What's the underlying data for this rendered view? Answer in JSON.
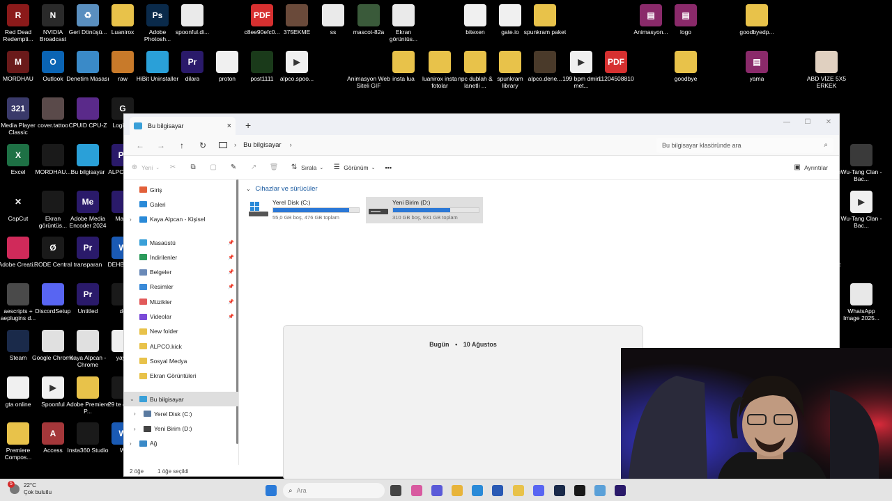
{
  "desktop": {
    "icons": [
      {
        "label": "Red Dead Redempti...",
        "color": "#8b1a1a",
        "glyph": "R"
      },
      {
        "label": "NVIDIA Broadcast",
        "color": "#2a2a2a",
        "glyph": "N"
      },
      {
        "label": "Geri Dönüşü...",
        "color": "#5a8fbf",
        "glyph": "♻"
      },
      {
        "label": "Luanirox",
        "color": "#e8c24a",
        "glyph": ""
      },
      {
        "label": "Adobe Photosh...",
        "color": "#0a2a4a",
        "glyph": "Ps"
      },
      {
        "label": "spoonful.di...",
        "color": "#eaeaea",
        "glyph": ""
      },
      {
        "label": "c8ee90efc0...",
        "color": "#d63030",
        "glyph": "PDF"
      },
      {
        "label": "375EKME",
        "color": "#6a4a3a",
        "glyph": ""
      },
      {
        "label": "ss",
        "color": "#eaeaea",
        "glyph": ""
      },
      {
        "label": "mascot-82a",
        "color": "#3a5a3a",
        "glyph": ""
      },
      {
        "label": "Ekran görüntüs...",
        "color": "#eaeaea",
        "glyph": ""
      },
      {
        "label": "bitexen",
        "color": "#f0f0f0",
        "glyph": ""
      },
      {
        "label": "gate.io",
        "color": "#f0f0f0",
        "glyph": ""
      },
      {
        "label": "spunkram paket",
        "color": "#e8c24a",
        "glyph": ""
      },
      {
        "label": "Animasyon...",
        "color": "#8a2a6a",
        "glyph": "▤"
      },
      {
        "label": "logo",
        "color": "#8a2a6a",
        "glyph": "▤"
      },
      {
        "label": "goodbyedp...",
        "color": "#e8c24a",
        "glyph": ""
      },
      {
        "label": "MORDHAU",
        "color": "#6a1a1a",
        "glyph": "M"
      },
      {
        "label": "Outlook",
        "color": "#0a64b4",
        "glyph": "O"
      },
      {
        "label": "Denetim Masası",
        "color": "#3a8ac8",
        "glyph": ""
      },
      {
        "label": "raw",
        "color": "#c87a2a",
        "glyph": ""
      },
      {
        "label": "HiBit Uninstaller",
        "color": "#2aa0d8",
        "glyph": ""
      },
      {
        "label": "dilara",
        "color": "#2a1a6a",
        "glyph": "Pr"
      },
      {
        "label": "proton",
        "color": "#f0f0f0",
        "glyph": ""
      },
      {
        "label": "post1111",
        "color": "#1a3a1a",
        "glyph": ""
      },
      {
        "label": "alpco.spoo...",
        "color": "#f0f0f0",
        "glyph": "▶"
      },
      {
        "label": "Animasyon Web Siteli GIF",
        "color": "#000000",
        "glyph": ""
      },
      {
        "label": "insta lua",
        "color": "#e8c24a",
        "glyph": ""
      },
      {
        "label": "luanirox insta fotolar",
        "color": "#e8c24a",
        "glyph": ""
      },
      {
        "label": "npc dublah & lanetli ...",
        "color": "#e8c24a",
        "glyph": ""
      },
      {
        "label": "spunkram library",
        "color": "#e8c24a",
        "glyph": ""
      },
      {
        "label": "alpco.dene...",
        "color": "#4a3a2a",
        "glyph": ""
      },
      {
        "label": "199 bpm dmin met...",
        "color": "#f0f0f0",
        "glyph": "▶"
      },
      {
        "label": "11204508810",
        "color": "#d63030",
        "glyph": "PDF"
      },
      {
        "label": "goodbye",
        "color": "#e8c24a",
        "glyph": ""
      },
      {
        "label": "yama",
        "color": "#8a2a6a",
        "glyph": "▤"
      },
      {
        "label": "ABD VİZE 5X5 ERKEK",
        "color": "#e0d0c0",
        "glyph": ""
      },
      {
        "label": "Media Player Classic",
        "color": "#3a3a6a",
        "glyph": "321"
      },
      {
        "label": "cover.tattoo",
        "color": "#5a4a4a",
        "glyph": ""
      },
      {
        "label": "CPUID CPU-Z",
        "color": "#5a2a8a",
        "glyph": ""
      },
      {
        "label": "Logit HI",
        "color": "#1a1a1a",
        "glyph": "G"
      },
      {
        "label": "Excel",
        "color": "#1e7145",
        "glyph": "X"
      },
      {
        "label": "MORDHAU...",
        "color": "#1a1a1a",
        "glyph": ""
      },
      {
        "label": "Bu bilgisayar",
        "color": "#2aa0d8",
        "glyph": ""
      },
      {
        "label": "ALPC SEK",
        "color": "#2a1a6a",
        "glyph": "Pr"
      },
      {
        "label": "CapCut",
        "color": "#000000",
        "glyph": "✕"
      },
      {
        "label": "Ekran görüntüs...",
        "color": "#1a1a1a",
        "glyph": ""
      },
      {
        "label": "Adobe Media Encoder 2024",
        "color": "#2a1a6a",
        "glyph": "Me"
      },
      {
        "label": "Mage",
        "color": "#2a1a6a",
        "glyph": ""
      },
      {
        "label": "Adobe Creati...",
        "color": "#d02a5a",
        "glyph": ""
      },
      {
        "label": "RODE Central",
        "color": "#1a1a1a",
        "glyph": "Ø"
      },
      {
        "label": "transparan",
        "color": "#2a1a6a",
        "glyph": "Pr"
      },
      {
        "label": "DEHB- pod",
        "color": "#1a5ab4",
        "glyph": "W"
      },
      {
        "label": "aescripts + aeplugins d...",
        "color": "#4a4a4a",
        "glyph": ""
      },
      {
        "label": "DiscordSetup",
        "color": "#5865f2",
        "glyph": ""
      },
      {
        "label": "Untitled",
        "color": "#2a1a6a",
        "glyph": "Pr"
      },
      {
        "label": "dc",
        "color": "#1a1a1a",
        "glyph": ""
      },
      {
        "label": "Steam",
        "color": "#1a2a4a",
        "glyph": ""
      },
      {
        "label": "Google Chrome",
        "color": "#e0e0e0",
        "glyph": ""
      },
      {
        "label": "Kaya Alpcan - Chrome",
        "color": "#e0e0e0",
        "glyph": ""
      },
      {
        "label": "yayır",
        "color": "#f0f0f0",
        "glyph": ""
      },
      {
        "label": "gta online",
        "color": "#f0f0f0",
        "glyph": ""
      },
      {
        "label": "Spoonful",
        "color": "#f0f0f0",
        "glyph": "▶"
      },
      {
        "label": "Adobe Premiere P...",
        "color": "#e8c24a",
        "glyph": ""
      },
      {
        "label": "29 te 4 ağu",
        "color": "#1a1a1a",
        "glyph": ""
      },
      {
        "label": "Premiere Compos...",
        "color": "#e8c24a",
        "glyph": ""
      },
      {
        "label": "Access",
        "color": "#a4373a",
        "glyph": "A"
      },
      {
        "label": "Insta360 Studio",
        "color": "#1a1a1a",
        "glyph": ""
      },
      {
        "label": "W",
        "color": "#1a5ab4",
        "glyph": "W"
      },
      {
        "label": "ne",
        "color": "#000000",
        "glyph": ""
      },
      {
        "label": "Wu-Tang Clan - Bac...",
        "color": "#3a3a3a",
        "glyph": ""
      },
      {
        "label": "Wu-Tang Clan - Bac...",
        "color": "#f0f0f0",
        "glyph": "▶"
      },
      {
        "label": "ist",
        "color": "#000000",
        "glyph": ""
      },
      {
        "label": "WhatsApp Image 2025...",
        "color": "#e8e8e8",
        "glyph": ""
      }
    ]
  },
  "explorer": {
    "tab_title": "Bu bilgisayar",
    "tab_close": "×",
    "new_tab": "+",
    "window_controls": {
      "minimize": "—",
      "maximize": "☐",
      "close": "✕"
    },
    "nav": {
      "back": "←",
      "forward": "→",
      "up": "↑",
      "refresh": "↻"
    },
    "breadcrumb": {
      "location": "Bu bilgisayar",
      "chevron": "›"
    },
    "search_placeholder": "Bu bilgisayar klasöründe ara",
    "commands": {
      "new": "Yeni",
      "sort": "Sırala",
      "view": "Görünüm",
      "more": "•••",
      "details": "Ayrıntılar"
    },
    "sidebar": {
      "top": [
        {
          "label": "Giriş",
          "color": "#e2603a"
        },
        {
          "label": "Galeri",
          "color": "#2a8ad8"
        },
        {
          "label": "Kaya Alpcan - Kişisel",
          "color": "#2a8ad8",
          "expandable": true
        }
      ],
      "pinned": [
        {
          "label": "Masaüstü",
          "color": "#3aa0d8"
        },
        {
          "label": "İndirilenler",
          "color": "#2a9a5a"
        },
        {
          "label": "Belgeler",
          "color": "#6a8ab8"
        },
        {
          "label": "Resimler",
          "color": "#3a8ad8"
        },
        {
          "label": "Müzikler",
          "color": "#e25a5a"
        },
        {
          "label": "Videolar",
          "color": "#7a4ad8"
        }
      ],
      "folders": [
        {
          "label": "New folder",
          "color": "#e8c24a"
        },
        {
          "label": "ALPCO.kick",
          "color": "#e8c24a"
        },
        {
          "label": "Sosyal Medya",
          "color": "#e8c24a"
        },
        {
          "label": "Ekran Görüntüleri",
          "color": "#e8c24a"
        }
      ],
      "this_pc": "Bu bilgisayar",
      "drives": [
        "Yerel Disk (C:)",
        "Yeni Birim (D:)"
      ],
      "network": "Ağ"
    },
    "section_title": "Cihazlar ve sürücüler",
    "drives": [
      {
        "name": "Yerel Disk (C:)",
        "info": "55,0 GB boş, 476 GB toplam",
        "used_fraction": 0.885
      },
      {
        "name": "Yeni Birim (D:)",
        "info": "310 GB boş, 931 GB toplam",
        "used_fraction": 0.667
      }
    ],
    "status": {
      "count": "2 öğe",
      "selected": "1 öğe seçildi"
    }
  },
  "popup": {
    "today": "Bugün",
    "bullet": "•",
    "date": "10 Ağustos"
  },
  "taskbar": {
    "weather_temp": "22°C",
    "weather_desc": "Çok bulutlu",
    "notification_count": "5",
    "search_placeholder": "Ara",
    "pinned_colors": [
      "#2a7ad8",
      "#444444",
      "#d85aa0",
      "#5a5ad8",
      "#e8b43a",
      "#2a8ad8",
      "#2a5ab4",
      "#e8c24a",
      "#5865f2",
      "#1a2a4a",
      "#1a1a1a",
      "#5aa0d8",
      "#2a1a6a"
    ]
  }
}
